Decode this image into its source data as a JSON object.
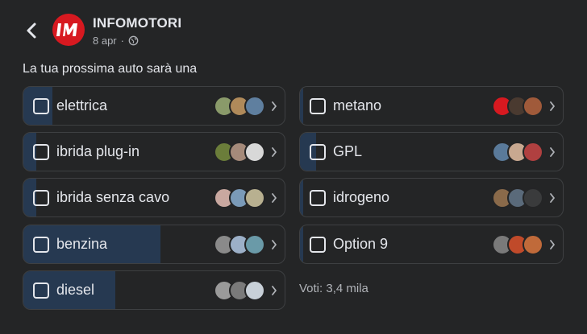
{
  "post": {
    "page_name": "INFOMOTORI",
    "date": "8 apr",
    "separator": "·",
    "logo_text": "IM",
    "question": "La tua prossima auto sarà una"
  },
  "poll": {
    "options": [
      {
        "label": "elettrica",
        "share": 0.11,
        "voter_colors": [
          "#8a9a6a",
          "#b08a5a",
          "#5f7f9f"
        ]
      },
      {
        "label": "ibrida plug-in",
        "share": 0.05,
        "voter_colors": [
          "#6b7d3a",
          "#a58a7a",
          "#d8d8d8"
        ]
      },
      {
        "label": "ibrida senza cavo",
        "share": 0.05,
        "voter_colors": [
          "#c9a8a0",
          "#7a9ab8",
          "#b8b090"
        ]
      },
      {
        "label": "benzina",
        "share": 0.52,
        "voter_colors": [
          "#8a8a8a",
          "#9cb0c8",
          "#6a9aa8"
        ]
      },
      {
        "label": "diesel",
        "share": 0.35,
        "voter_colors": [
          "#9a9a9a",
          "#7a7a7a",
          "#c8d0d8"
        ]
      },
      {
        "label": "metano",
        "share": 0.01,
        "voter_colors": [
          "#d71920",
          "#4a3a30",
          "#a05a3a"
        ]
      },
      {
        "label": "GPL",
        "share": 0.06,
        "voter_colors": [
          "#5a7a9a",
          "#c8a890",
          "#b04040"
        ]
      },
      {
        "label": "idrogeno",
        "share": 0.01,
        "voter_colors": [
          "#8a6a4a",
          "#5a6a7a",
          "#3a3b3c"
        ]
      },
      {
        "label": "Option 9",
        "share": 0.01,
        "voter_colors": [
          "#7a7a7a",
          "#c04a2a",
          "#c06a3a"
        ]
      }
    ],
    "votes_text": "Voti: 3,4 mila"
  },
  "colors": {
    "background": "#242526",
    "fill": "#263951",
    "border": "#3e4042",
    "brand_red": "#d71920"
  },
  "icons": [
    "back-arrow-icon",
    "globe-icon",
    "checkbox-icon",
    "chevron-right-icon"
  ]
}
